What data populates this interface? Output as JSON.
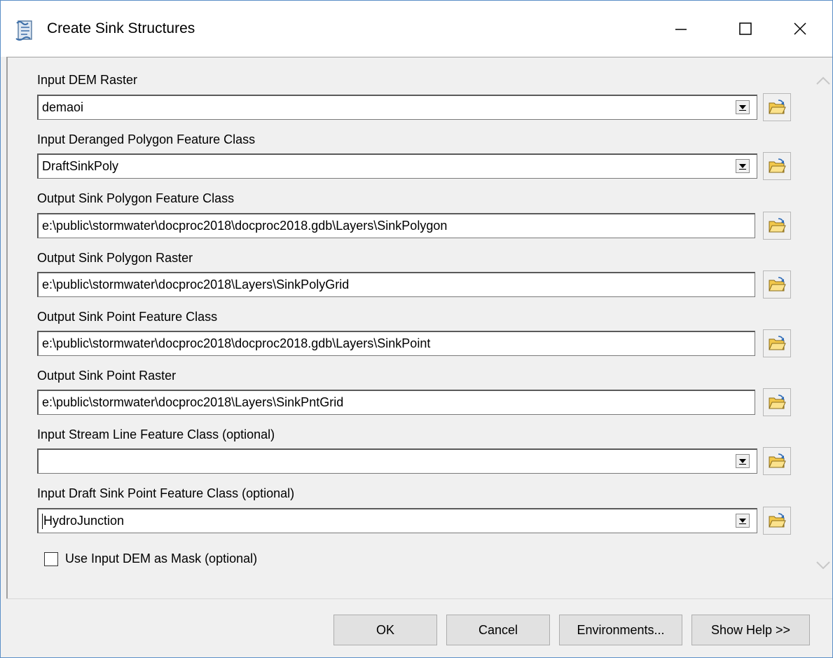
{
  "window": {
    "title": "Create Sink Structures",
    "icon": "script-tool-icon",
    "controls": [
      "minimize",
      "maximize",
      "close"
    ]
  },
  "params": [
    {
      "label": "Input DEM Raster",
      "value": "demaoi",
      "type": "combo"
    },
    {
      "label": "Input Deranged Polygon Feature Class",
      "value": "DraftSinkPoly",
      "type": "combo"
    },
    {
      "label": "Output Sink Polygon Feature Class",
      "value": "e:\\public\\stormwater\\docproc2018\\docproc2018.gdb\\Layers\\SinkPolygon",
      "type": "text"
    },
    {
      "label": "Output Sink Polygon Raster",
      "value": "e:\\public\\stormwater\\docproc2018\\Layers\\SinkPolyGrid",
      "type": "text"
    },
    {
      "label": "Output Sink Point Feature Class",
      "value": "e:\\public\\stormwater\\docproc2018\\docproc2018.gdb\\Layers\\SinkPoint",
      "type": "text"
    },
    {
      "label": "Output Sink Point Raster",
      "value": "e:\\public\\stormwater\\docproc2018\\Layers\\SinkPntGrid",
      "type": "text"
    },
    {
      "label": "Input Stream Line Feature Class (optional)",
      "value": "",
      "type": "combo"
    },
    {
      "label": "Input Draft Sink Point Feature Class (optional)",
      "value": "HydroJunction",
      "type": "combo"
    }
  ],
  "checkbox": {
    "label": "Use Input DEM as Mask (optional)",
    "checked": false
  },
  "buttons": {
    "ok": "OK",
    "cancel": "Cancel",
    "environments": "Environments...",
    "help": "Show Help >>"
  },
  "colors": {
    "window_border": "#5b8fc7",
    "dialog_bg": "#f0f0f0",
    "folder_yellow": "#f2c84b"
  }
}
